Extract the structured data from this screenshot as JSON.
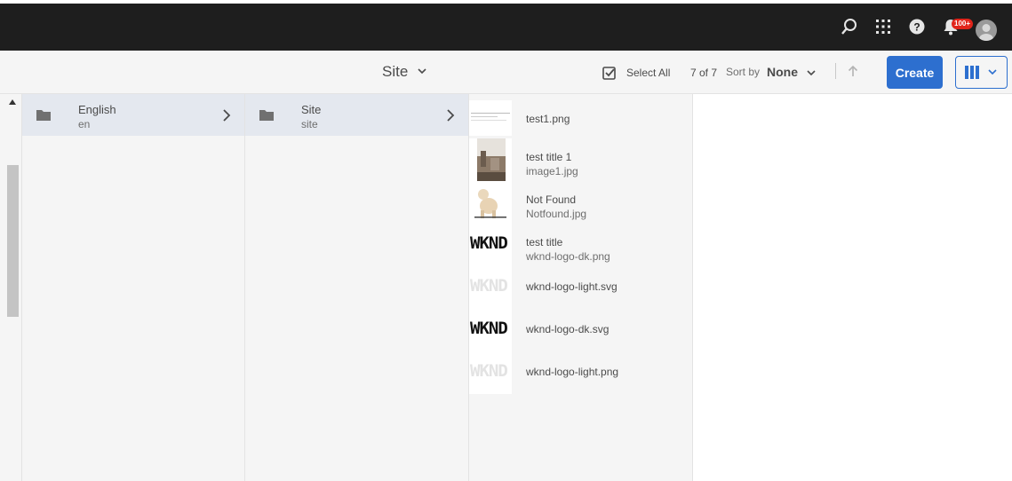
{
  "topbar": {
    "icons": [
      "search-icon",
      "apps-grid-icon",
      "help-icon",
      "bell-icon",
      "avatar"
    ],
    "notification_badge": "100+"
  },
  "toolbar": {
    "title": "Site",
    "select_all": "Select All",
    "count": "7 of 7",
    "sort_label": "Sort by",
    "sort_value": "None",
    "create_label": "Create",
    "accent": "#2d6fcf"
  },
  "columns": {
    "col1": {
      "name": "English",
      "sub": "en"
    },
    "col2": {
      "name": "Site",
      "sub": "site"
    }
  },
  "assets": [
    {
      "title": "test1.png",
      "file": ""
    },
    {
      "title": "test title 1",
      "file": "image1.jpg"
    },
    {
      "title": "Not Found",
      "file": "Notfound.jpg"
    },
    {
      "title": "test title",
      "file": "wknd-logo-dk.png"
    },
    {
      "title": "wknd-logo-light.svg",
      "file": ""
    },
    {
      "title": "wknd-logo-dk.svg",
      "file": ""
    },
    {
      "title": "wknd-logo-light.png",
      "file": ""
    }
  ],
  "logo_text": "WKND"
}
